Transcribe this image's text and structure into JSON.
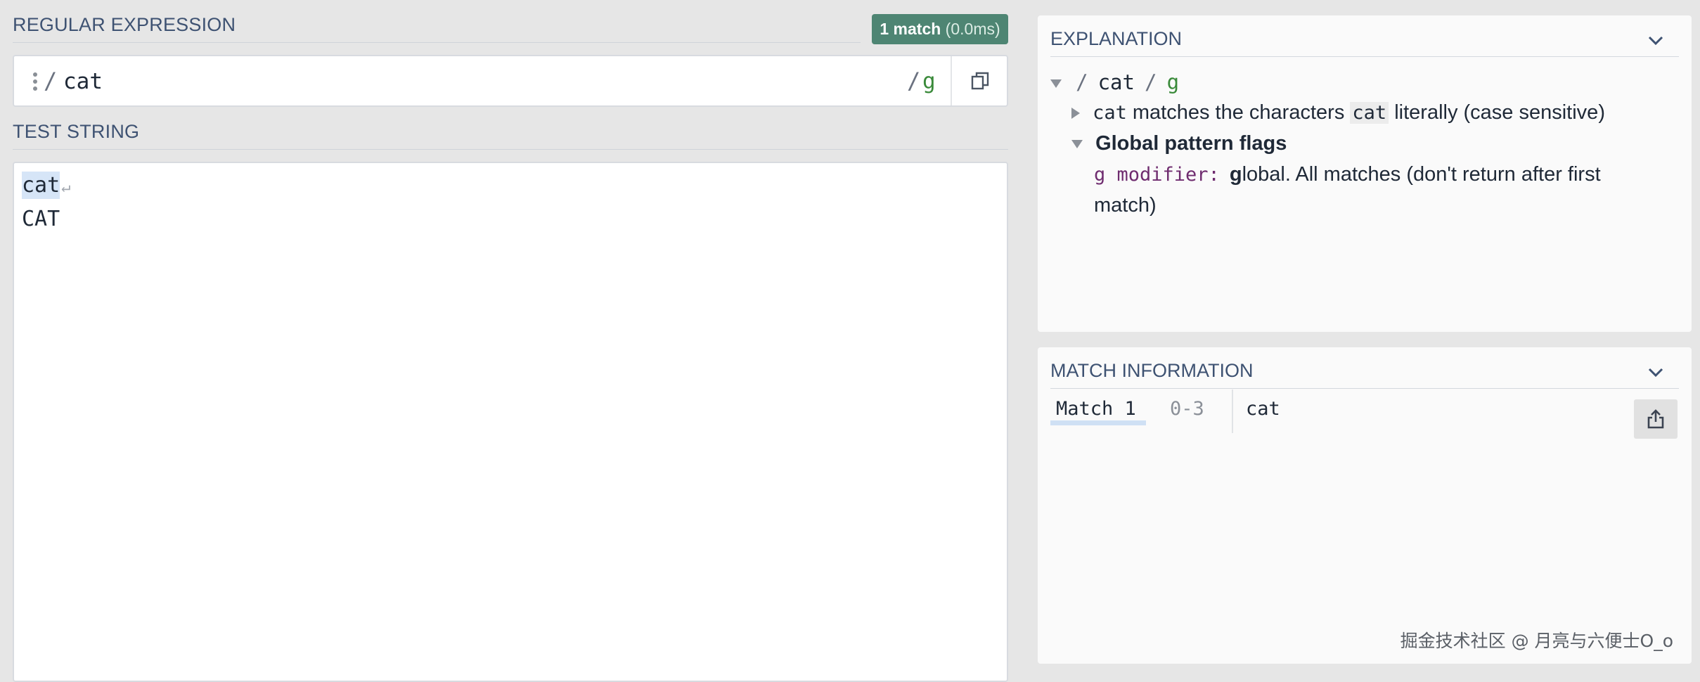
{
  "regex_section": {
    "title": "REGULAR EXPRESSION",
    "badge_count": "1 match",
    "badge_time": " (0.0ms)",
    "open_delim": "/",
    "pattern": "cat",
    "close_delim": "/",
    "flags": "g"
  },
  "test_section": {
    "title": "TEST STRING",
    "lines": [
      "cat",
      "CAT"
    ],
    "highlighted_match": "cat",
    "newline_glyph": "↵"
  },
  "explanation": {
    "title": "EXPLANATION",
    "root_open": "/",
    "root_pattern": "cat",
    "root_close": "/",
    "root_flags": "g",
    "token_code": "cat",
    "token_text_1": " matches the characters ",
    "token_chip": "cat",
    "token_text_2": " literally (case sensitive)",
    "flags_heading": "Global pattern flags",
    "modifier_code": "g modifier:",
    "modifier_bold": "g",
    "modifier_text_line1": "lobal. All matches (don't return after first",
    "modifier_text_line2": "match)"
  },
  "match_info": {
    "title": "MATCH INFORMATION",
    "match_label": "Match 1",
    "range": "0-3",
    "value": "cat"
  },
  "watermark": "掘金技术社区 @ 月亮与六便士O_o",
  "colors": {
    "badge": "#4e8573",
    "highlight": "#d6e5f7",
    "flag_green": "#3a8a3a",
    "modifier_purple": "#6f2c6f",
    "title_blue": "#3e5272"
  }
}
